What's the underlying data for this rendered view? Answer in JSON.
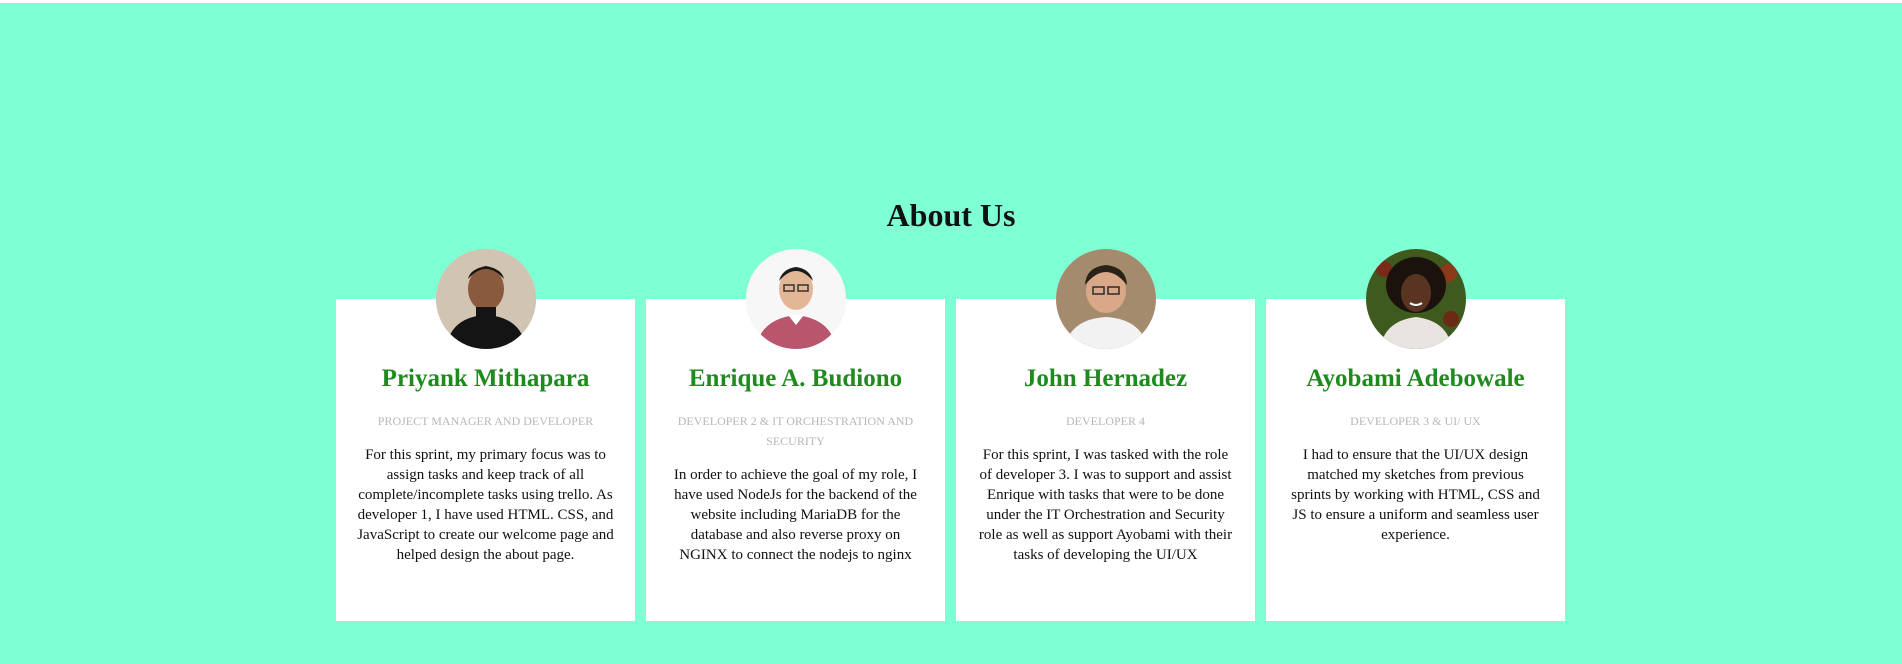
{
  "section": {
    "title": "About Us"
  },
  "team": [
    {
      "name": "Priyank Mithapara",
      "role": "PROJECT MANAGER AND DEVELOPER",
      "bio": "For this sprint, my primary focus was to assign tasks and keep track of all complete/incomplete tasks using trello. As developer 1, I have used HTML. CSS, and JavaScript to create our welcome page and helped design the about page.",
      "avatar_icon": "person-photo-icon"
    },
    {
      "name": "Enrique A. Budiono",
      "role": "DEVELOPER 2 & IT ORCHESTRATION AND SECURITY",
      "bio": "In order to achieve the goal of my role, I have used NodeJs for the backend of the website including MariaDB for the database and also reverse proxy on NGINX to connect the nodejs to nginx",
      "avatar_icon": "person-photo-icon"
    },
    {
      "name": "John Hernadez",
      "role": "DEVELOPER 4",
      "bio": "For this sprint, I was tasked with the role of developer 3. I was to support and assist Enrique with tasks that were to be done under the IT Orchestration and Security role as well as support Ayobami with their tasks of developing the UI/UX",
      "avatar_icon": "person-photo-icon"
    },
    {
      "name": "Ayobami Adebowale",
      "role": "DEVELOPER 3 & UI/ UX",
      "bio": "I had to ensure that the UI/UX design matched my sketches from previous sprints by working with HTML, CSS and JS to ensure a uniform and seamless user experience.",
      "avatar_icon": "person-photo-icon"
    }
  ],
  "colors": {
    "background": "#7fffd4",
    "card": "#ffffff",
    "name": "#1f8b1f",
    "role": "#b7b7b7",
    "text": "#111111"
  }
}
